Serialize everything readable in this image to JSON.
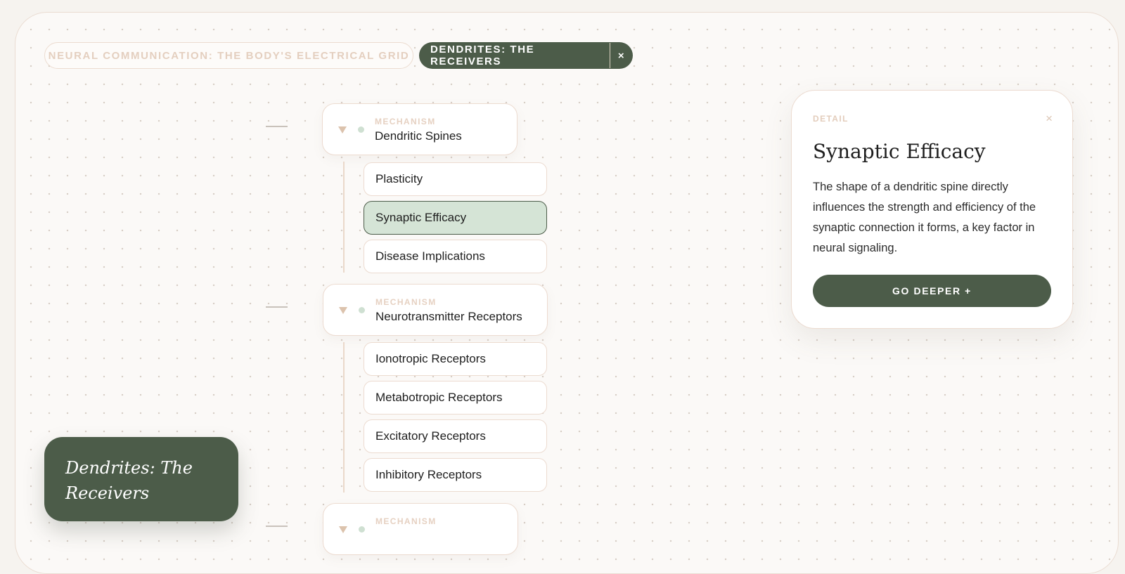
{
  "breadcrumb": {
    "root_label": "Neural Communication: The Body's Electrical Grid",
    "active_label": "Dendrites: The Receivers",
    "close_glyph": "×"
  },
  "tree": {
    "groups": [
      {
        "kind": "Mechanism",
        "title": "Dendritic Spines",
        "children": [
          "Plasticity",
          "Synaptic Efficacy",
          "Disease Implications"
        ]
      },
      {
        "kind": "Mechanism",
        "title": "Neurotransmitter Receptors",
        "children": [
          "Ionotropic Receptors",
          "Metabotropic Receptors",
          "Excitatory Receptors",
          "Inhibitory Receptors"
        ]
      },
      {
        "kind": "Mechanism",
        "title": "",
        "children": []
      }
    ],
    "selected_child": "Synaptic Efficacy"
  },
  "title_card": {
    "text": "Dendrites: The Receivers"
  },
  "detail": {
    "kicker": "Detail",
    "close_glyph": "×",
    "heading": "Synaptic Efficacy",
    "body": "The shape of a dendritic spine directly influences the strength and efficiency of the synaptic connection it forms, a key factor in neural signaling.",
    "cta_label": "Go deeper +"
  },
  "colors": {
    "accent": "#4c5c49",
    "selected_fill": "#d5e4d6",
    "border": "#ecdbd0"
  }
}
